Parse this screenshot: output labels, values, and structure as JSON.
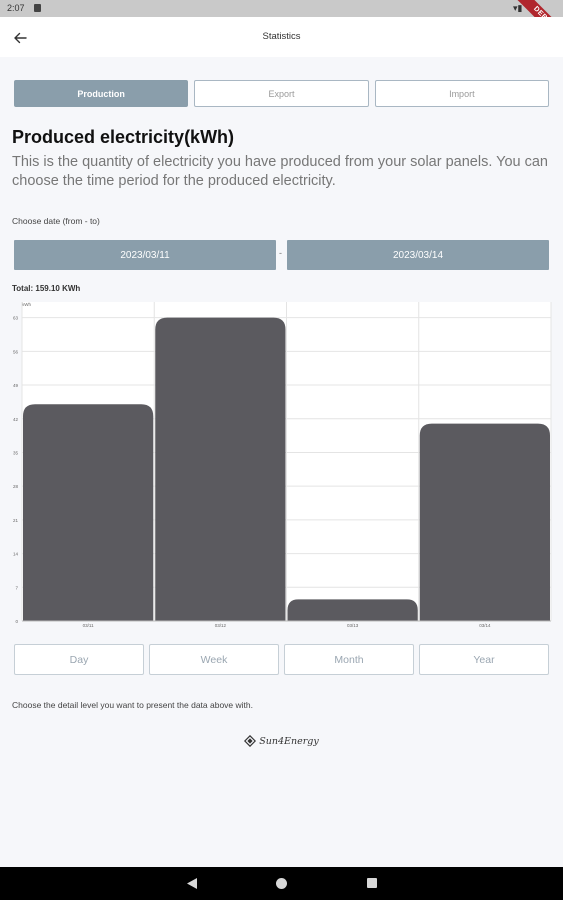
{
  "status_bar": {
    "time": "2:07"
  },
  "debug_banner": "DEBUG",
  "app_bar": {
    "title": "Statistics"
  },
  "tabs": [
    {
      "label": "Production",
      "active": true
    },
    {
      "label": "Export",
      "active": false
    },
    {
      "label": "Import",
      "active": false
    }
  ],
  "heading": "Produced electricity(kWh)",
  "description": "This is the quantity of electricity you have produced from your solar panels. You can choose the time period for the  produced electricity.",
  "date_range": {
    "label": "Choose date (from - to)",
    "from": "2023/03/11",
    "separator": "-",
    "to": "2023/03/14"
  },
  "total": "Total: 159.10 KWh",
  "chart_data": {
    "type": "bar",
    "ylabel": "kWh",
    "y_ticks": [
      "0",
      "7",
      "14",
      "21",
      "28",
      "35",
      "42",
      "49",
      "56",
      "63"
    ],
    "ylim": [
      0,
      65
    ],
    "categories": [
      "03/11",
      "03/12",
      "03/13",
      "03/14"
    ],
    "values": [
      45,
      63,
      4.5,
      41
    ],
    "bar_color": "#5b5a5f",
    "grid": true
  },
  "period_buttons": [
    "Day",
    "Week",
    "Month",
    "Year"
  ],
  "hint": "Choose the detail level you want to present the data above with.",
  "logo_text": "Sun4Energy",
  "colors": {
    "accent": "#8a9eab",
    "bar": "#5b5a5f",
    "background": "#f6f7fa"
  }
}
